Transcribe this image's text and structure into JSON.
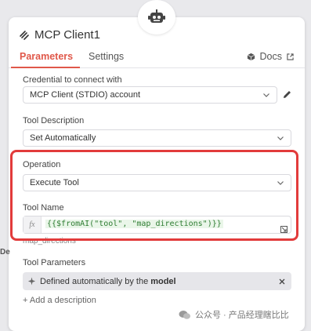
{
  "node": {
    "title": "MCP Client1"
  },
  "tabs": [
    {
      "label": "Parameters",
      "active": true
    },
    {
      "label": "Settings",
      "active": false
    }
  ],
  "docs_label": "Docs",
  "credential": {
    "label": "Credential to connect with",
    "value": "MCP Client (STDIO) account"
  },
  "tool_description": {
    "label": "Tool Description",
    "value": "Set Automatically"
  },
  "operation": {
    "label": "Operation",
    "value": "Execute Tool"
  },
  "tool_name": {
    "label": "Tool Name",
    "fx": "fx",
    "expression": "{{$fromAI(\"tool\", \"map_directions\")}}",
    "preview": "map_directions"
  },
  "tool_parameters": {
    "label": "Tool Parameters",
    "chip_prefix": "Defined automatically by the",
    "chip_bold": "model"
  },
  "add_description": "+ Add a description",
  "background_text": "De",
  "watermark": "公众号 · 产品经理瞎比比",
  "colors": {
    "accent": "#e0584a",
    "highlight": "#e23b3b",
    "expression_green": "#2e7d32"
  }
}
